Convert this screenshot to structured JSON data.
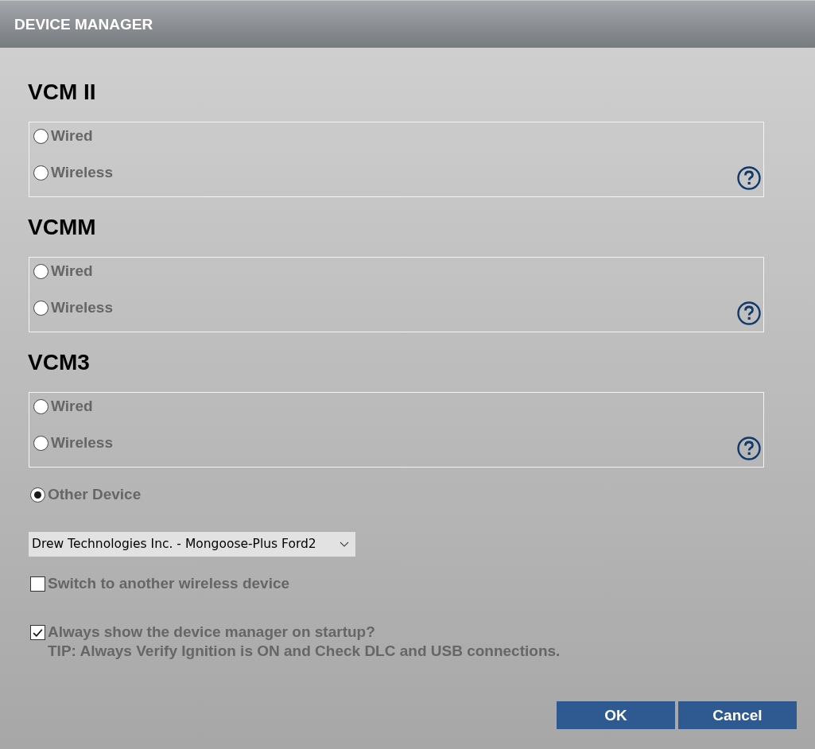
{
  "window": {
    "title": "DEVICE MANAGER"
  },
  "device_groups": [
    {
      "heading": "VCM II",
      "options": [
        {
          "label": "Wired",
          "selected": false
        },
        {
          "label": "Wireless",
          "selected": false
        }
      ]
    },
    {
      "heading": "VCMM",
      "options": [
        {
          "label": "Wired",
          "selected": false
        },
        {
          "label": "Wireless",
          "selected": false
        }
      ]
    },
    {
      "heading": "VCM3",
      "options": [
        {
          "label": "Wired",
          "selected": false
        },
        {
          "label": "Wireless",
          "selected": false
        }
      ]
    }
  ],
  "other_device": {
    "label": "Other Device",
    "selected": true
  },
  "device_dropdown": {
    "value": "Drew Technologies Inc. - Mongoose-Plus Ford2"
  },
  "checkboxes": [
    {
      "label": "Switch to another wireless device",
      "checked": false
    },
    {
      "label": "Always show the device manager on startup?",
      "checked": true
    }
  ],
  "tip": "TIP: Always Verify Ignition is ON and Check DLC and USB connections.",
  "buttons": [
    {
      "label": "OK"
    },
    {
      "label": "Cancel"
    }
  ]
}
